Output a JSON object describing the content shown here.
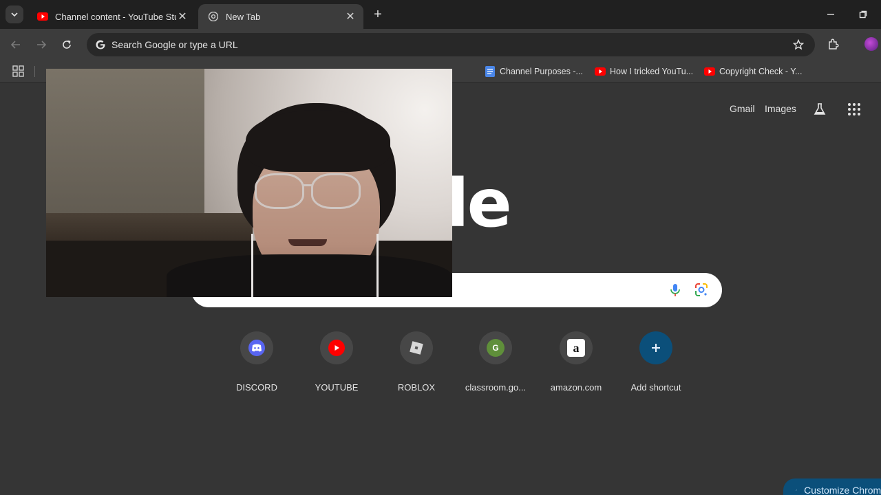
{
  "tabs": [
    {
      "title": "Channel content - YouTube Studio",
      "favicon": "youtube-icon",
      "active": false
    },
    {
      "title": "New Tab",
      "favicon": "chrome-icon",
      "active": true
    }
  ],
  "toolbar": {
    "omnibox_placeholder": "Search Google or type a URL"
  },
  "bookmarks": [
    {
      "label": "Channel Purposes -...",
      "icon": "docs-icon"
    },
    {
      "label": "How I tricked YouTu...",
      "icon": "youtube-icon"
    },
    {
      "label": "Copyright Check - Y...",
      "icon": "youtube-icon"
    }
  ],
  "ntp": {
    "gmail_label": "Gmail",
    "images_label": "Images",
    "logo_partial": "ogle",
    "shortcuts": [
      {
        "label": "DISCORD",
        "icon": "discord-icon"
      },
      {
        "label": "YOUTUBE",
        "icon": "youtube-icon"
      },
      {
        "label": "ROBLOX",
        "icon": "roblox-icon"
      },
      {
        "label": "classroom.go...",
        "icon": "classroom-icon",
        "letter": "G"
      },
      {
        "label": "amazon.com",
        "icon": "amazon-icon",
        "letter": "a"
      },
      {
        "label": "Add shortcut",
        "icon": "plus-icon"
      }
    ],
    "customize_label": "Customize Chrome"
  },
  "colors": {
    "page_bg": "#353535",
    "tabstrip_bg": "#202020",
    "toolbar_bg": "#3c3c3c",
    "youtube_red": "#ff0000",
    "discord_blurple": "#5865f2",
    "customize_bg": "#0b4f7a"
  }
}
